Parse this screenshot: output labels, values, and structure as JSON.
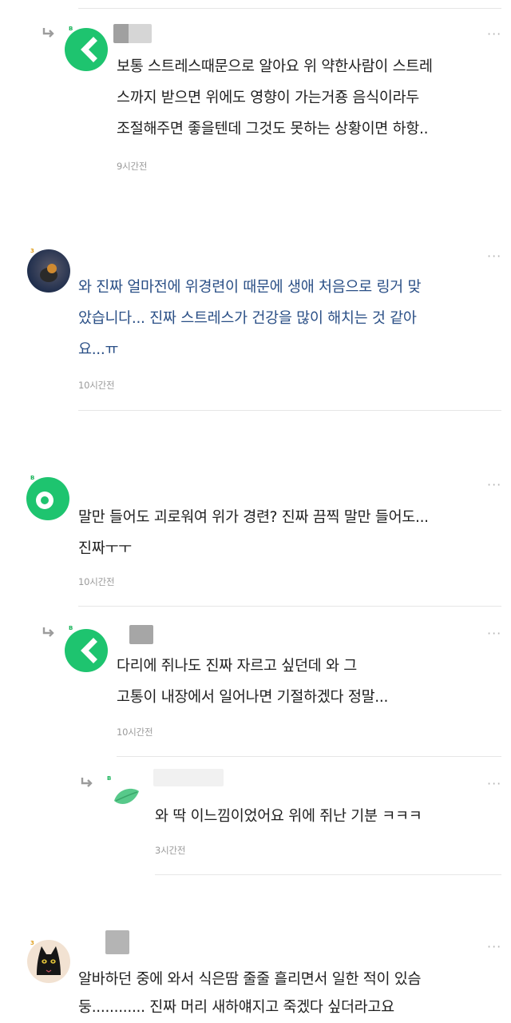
{
  "colors": {
    "green": "#1ec46f",
    "blue_text": "#2a4f86",
    "time_gray": "#9a9a9a"
  },
  "comments": [
    {
      "lines": [
        "보통 스트레스때문으로 알아요 위 약한사람이 스트레",
        "스까지 받으면 위에도 영향이 가는거죵 음식이라두",
        "조절해주면 좋을텐데 그것도 못하는 상황이면 하항.."
      ],
      "time": "9시간전",
      "more": "···"
    },
    {
      "lines": [
        "와 진짜 얼마전에 위경련이 때문에 생애 처음으로 링거 맞",
        "았습니다... 진짜 스트레스가 건강을 많이 해치는 것 같아",
        "요...ㅠ"
      ],
      "time": "10시간전",
      "more": "···"
    },
    {
      "lines": [
        "말만 들어도 괴로워여 위가 경련? 진짜 끔찍 말만 들어도...",
        "진짜ㅜㅜ"
      ],
      "time": "10시간전",
      "more": "···"
    },
    {
      "lines": [
        "다리에 쥐나도 진짜 자르고 싶던데 와 그",
        "고통이 내장에서 일어나면 기절하겠다 정말..."
      ],
      "time": "10시간전",
      "more": "···"
    },
    {
      "lines": [
        "와 딱 이느낌이었어요 위에 쥐난 기분 ㅋㅋㅋ"
      ],
      "time": "3시간전",
      "more": "···"
    },
    {
      "lines": [
        "알바하던 중에 와서 식은땀 줄줄 흘리면서 일한 적이 있슴",
        "둥............ 진짜 머리 새하얘지고 죽겠다 싶더라고요"
      ],
      "more": "···"
    }
  ],
  "icons": {
    "reply": "reply-arrow-icon",
    "more": "more-options-icon",
    "avatar_green_c": "green-c-avatar-icon",
    "avatar_green_ring": "green-ring-avatar-icon",
    "avatar_leaf": "leaf-avatar-icon",
    "avatar_photo": "photo-avatar",
    "avatar_cat": "black-cat-avatar"
  }
}
